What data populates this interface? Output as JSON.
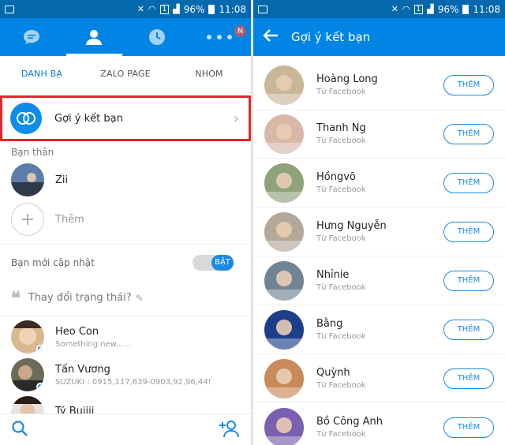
{
  "status_bar": {
    "battery": "96%",
    "time": "11:08",
    "sim": "1"
  },
  "left": {
    "notif_badge": "N",
    "subtabs": [
      "DANH BẠ",
      "ZALO PAGE",
      "NHÓM"
    ],
    "suggest_label": "Gợi ý kết bạn",
    "close_friends_title": "Bạn thân",
    "close_friend": {
      "name": "Zii"
    },
    "add_label": "Thêm",
    "recent_updates_label": "Bạn mới cập nhật",
    "toggle_label": "BẬT",
    "status_prompt": "Thay đổi trạng thái?",
    "friends": [
      {
        "name": "Heo Con",
        "sub": "Something new......"
      },
      {
        "name": "Tấn Vương",
        "sub": "SUZUKI : 0915,117,639-0903,92,96,44!"
      },
      {
        "name": "Tý Bụiiii",
        "sub": ""
      }
    ]
  },
  "right": {
    "title": "Gợi ý kết bạn",
    "add_button_label": "THÊM",
    "suggestions": [
      {
        "name": "Hoàng Long",
        "sub": "Từ Facebook",
        "color": "#c9b79a"
      },
      {
        "name": "Thanh Ng",
        "sub": "Từ Facebook",
        "color": "#d9b8a8"
      },
      {
        "name": "Hồngvõ",
        "sub": "Từ Facebook",
        "color": "#8fa37a"
      },
      {
        "name": "Hưng Nguyễn",
        "sub": "Từ Facebook",
        "color": "#b4a89a"
      },
      {
        "name": "Nhỉnie",
        "sub": "Từ Facebook",
        "color": "#6f8596"
      },
      {
        "name": "Bằng",
        "sub": "Từ Facebook",
        "color": "#1d3f8a"
      },
      {
        "name": "Quỳnh",
        "sub": "Từ Facebook",
        "color": "#c88a5a"
      },
      {
        "name": "Bồ Công Anh",
        "sub": "Từ Facebook",
        "color": "#7b5fb0"
      }
    ]
  },
  "colors": {
    "primary": "#0085e5",
    "status_bar": "#0468ad",
    "highlight_border": "#e1262e"
  }
}
